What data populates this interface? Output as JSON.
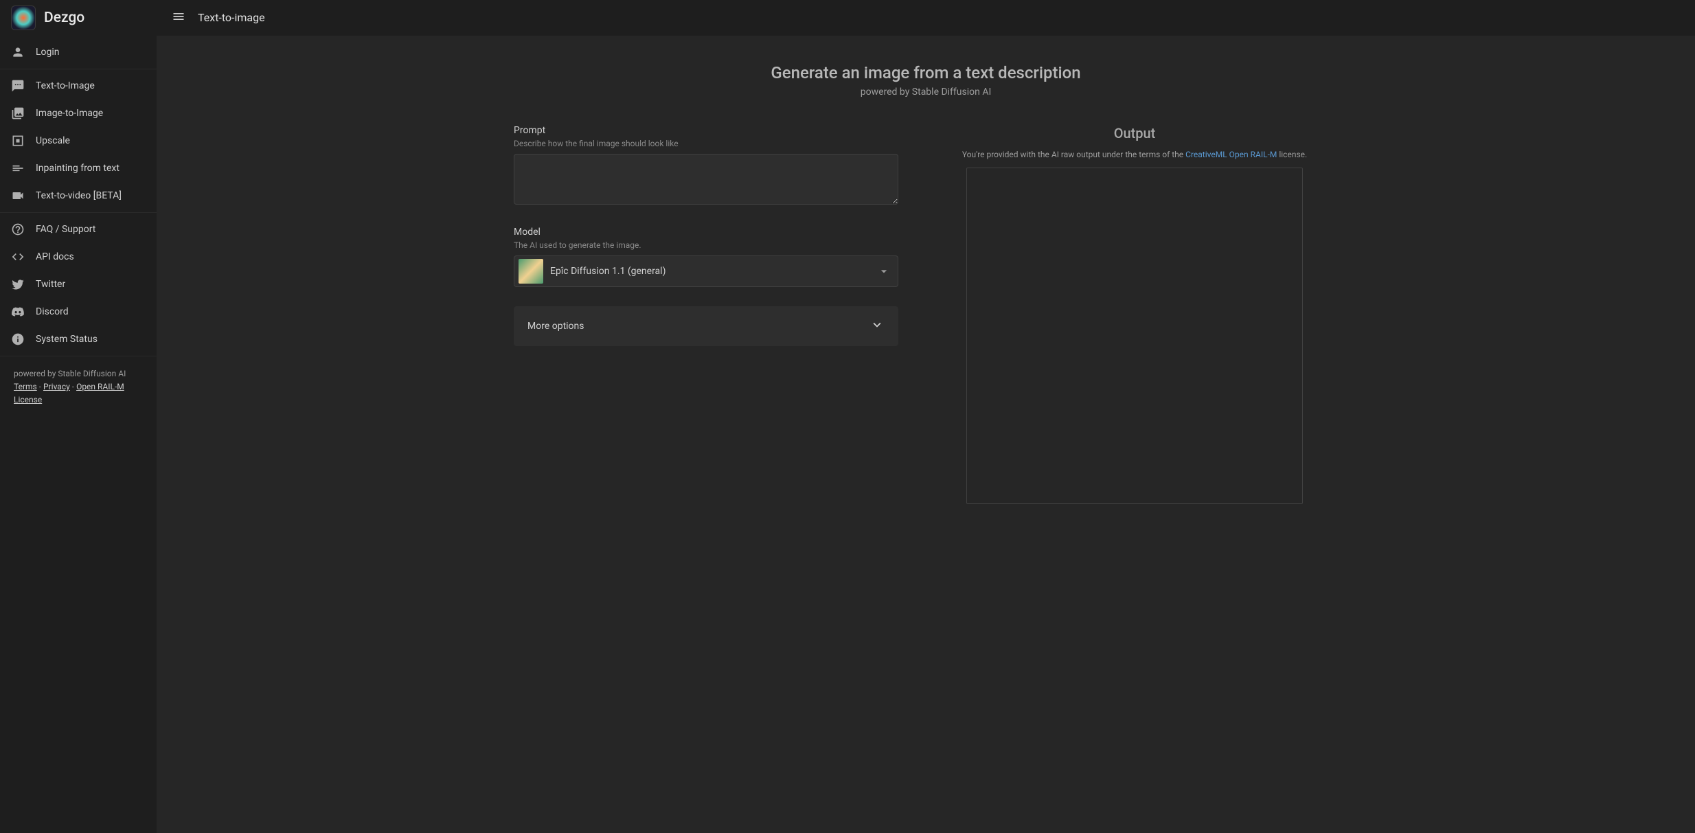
{
  "brand": {
    "name": "Dezgo"
  },
  "topbar": {
    "title": "Text-to-image"
  },
  "sidebar": {
    "login": "Login",
    "nav": [
      {
        "label": "Text-to-Image"
      },
      {
        "label": "Image-to-Image"
      },
      {
        "label": "Upscale"
      },
      {
        "label": "Inpainting from text"
      },
      {
        "label": "Text-to-video [BETA]"
      }
    ],
    "support": [
      {
        "label": "FAQ / Support"
      },
      {
        "label": "API docs"
      },
      {
        "label": "Twitter"
      },
      {
        "label": "Discord"
      },
      {
        "label": "System Status"
      }
    ],
    "footer": {
      "powered": "powered by Stable Diffusion AI",
      "terms": "Terms",
      "privacy": "Privacy",
      "license": "Open RAIL-M License"
    }
  },
  "page": {
    "title": "Generate an image from a text description",
    "subtitle": "powered by Stable Diffusion AI"
  },
  "form": {
    "prompt": {
      "label": "Prompt",
      "hint": "Describe how the final image should look like",
      "value": ""
    },
    "model": {
      "label": "Model",
      "hint": "The AI used to generate the image.",
      "selected": "Epîc Diffusion 1.1 (general)"
    },
    "more_options": "More options"
  },
  "output": {
    "heading": "Output",
    "terms_prefix": "You're provided with the AI raw output under the terms of the ",
    "terms_link": "CreativeML Open RAIL-M",
    "terms_suffix": " license."
  }
}
